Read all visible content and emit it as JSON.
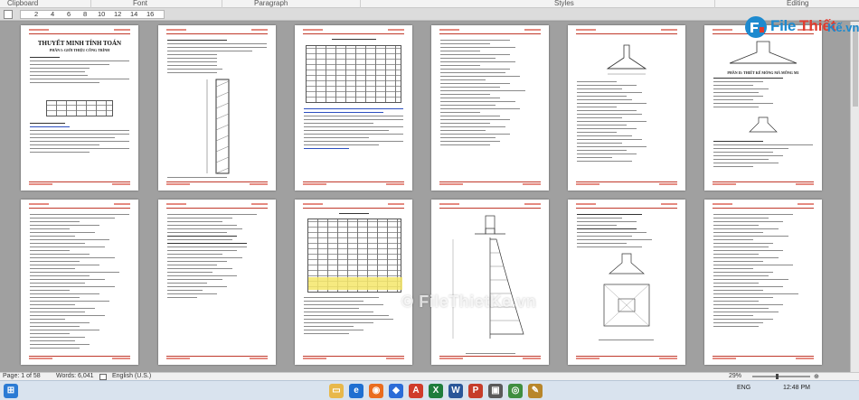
{
  "ribbon": {
    "groups": [
      "Clipboard",
      "Font",
      "Paragraph",
      "Styles",
      "Editing"
    ]
  },
  "ruler": {
    "ticks": [
      "2",
      "4",
      "6",
      "8",
      "10",
      "12",
      "14",
      "16"
    ]
  },
  "pages": {
    "p1_title": "THUYẾT MINH TÍNH TOÁN",
    "p1_sub": "PHẦN I: GIỚI THIỆU CÔNG TRÌNH",
    "p6_sub": "PHẦN II: THIẾT KẾ MÓNG MÁ MỐNG M1"
  },
  "logo": {
    "part1": "File",
    "part2": "Thiết",
    "part3": "Kế.vn"
  },
  "watermark": "© FileThietKe.vn",
  "status": {
    "page": "Page: 1 of 58",
    "words": "Words: 6,041",
    "language": "English (U.S.)",
    "zoom": "29%"
  },
  "taskbar": {
    "lang": "ENG",
    "time": "12:48 PM"
  },
  "colors": {
    "accent": "#1d8acf",
    "brand_red": "#e23b2e",
    "header_rule": "#c0392b"
  }
}
